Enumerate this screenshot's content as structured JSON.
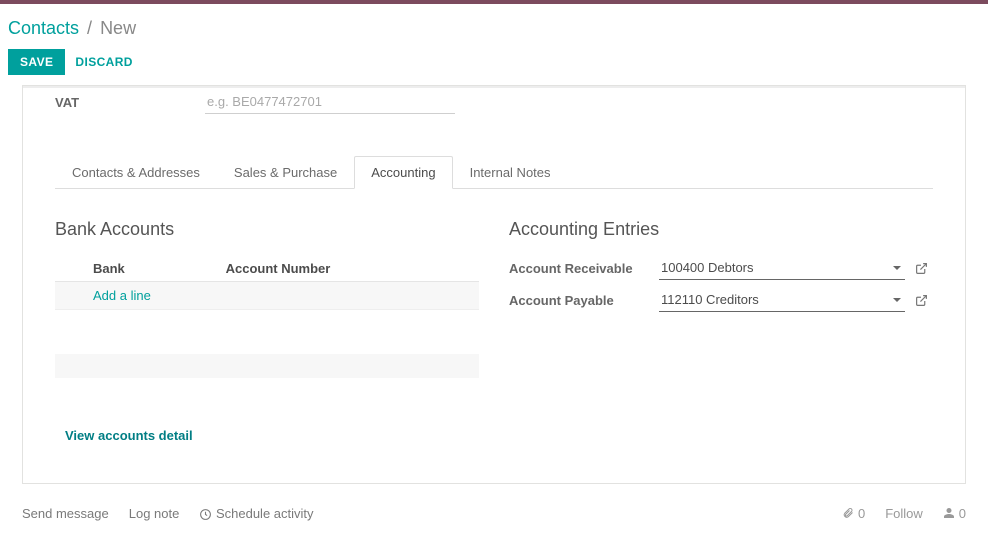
{
  "breadcrumb": {
    "root": "Contacts",
    "separator": "/",
    "current": "New"
  },
  "actions": {
    "save": "SAVE",
    "discard": "DISCARD"
  },
  "vat": {
    "label": "VAT",
    "placeholder": "e.g. BE0477472701",
    "value": ""
  },
  "tabs": {
    "contacts": "Contacts & Addresses",
    "sales": "Sales & Purchase",
    "accounting": "Accounting",
    "notes": "Internal Notes"
  },
  "bank": {
    "title": "Bank Accounts",
    "col_bank": "Bank",
    "col_acct": "Account Number",
    "add_line": "Add a line",
    "view_detail": "View accounts detail"
  },
  "entries": {
    "title": "Accounting Entries",
    "receivable_label": "Account Receivable",
    "receivable_value": "100400 Debtors",
    "payable_label": "Account Payable",
    "payable_value": "112110 Creditors"
  },
  "chatter": {
    "send": "Send message",
    "log": "Log note",
    "schedule": "Schedule activity",
    "attach_count": "0",
    "follow": "Follow",
    "follower_count": "0"
  }
}
